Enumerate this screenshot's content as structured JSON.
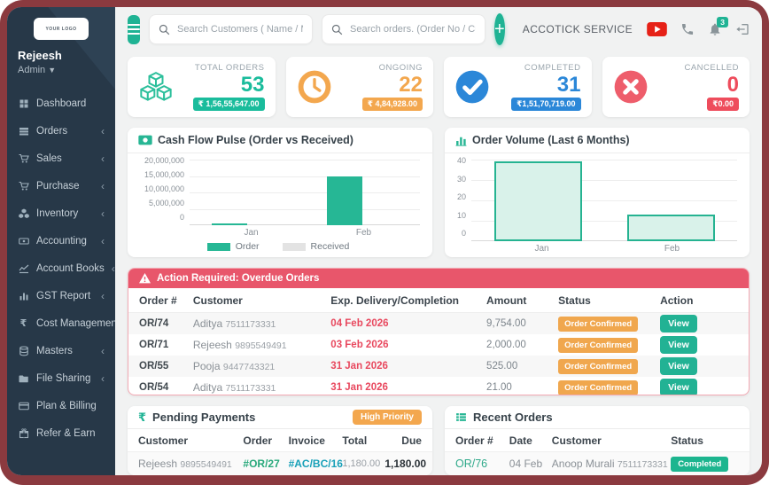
{
  "sidebar": {
    "logo_text": "YOUR LOGO",
    "user_name": "Rejeesh",
    "user_role": "Admin",
    "items": [
      {
        "label": "Dashboard",
        "expandable": false
      },
      {
        "label": "Orders",
        "expandable": true
      },
      {
        "label": "Sales",
        "expandable": true
      },
      {
        "label": "Purchase",
        "expandable": true
      },
      {
        "label": "Inventory",
        "expandable": true
      },
      {
        "label": "Accounting",
        "expandable": true
      },
      {
        "label": "Account Books",
        "expandable": true
      },
      {
        "label": "GST Report",
        "expandable": true
      },
      {
        "label": "Cost Management",
        "expandable": true
      },
      {
        "label": "Masters",
        "expandable": true
      },
      {
        "label": "File Sharing",
        "expandable": true
      },
      {
        "label": "Plan & Billing",
        "expandable": false
      },
      {
        "label": "Refer & Earn",
        "expandable": false
      }
    ],
    "chevron": "‹"
  },
  "header": {
    "search_customers_placeholder": "Search Customers ( Name / Mobile / GSTIN",
    "search_orders_placeholder": "Search orders. (Order No / Customer Name,",
    "add_button": "+",
    "company_name": "ACCOTICK SERVICE",
    "notification_count": "3"
  },
  "stats": [
    {
      "label": "TOTAL ORDERS",
      "value": "53",
      "amount": "₹ 1,56,55,647.00",
      "color": "#1abc9c",
      "icon": "cubes-icon"
    },
    {
      "label": "ONGOING",
      "value": "22",
      "amount": "₹ 4,84,928.00",
      "color": "#f3a74e",
      "icon": "clock-icon"
    },
    {
      "label": "COMPLETED",
      "value": "31",
      "amount": "₹1,51,70,719.00",
      "color": "#2b87d8",
      "icon": "check-circle-icon"
    },
    {
      "label": "CANCELLED",
      "value": "0",
      "amount": "₹0.00",
      "color": "#ee5d6b",
      "icon": "x-circle-icon"
    }
  ],
  "chart_data": [
    {
      "type": "bar",
      "title": "Cash Flow Pulse (Order vs Received)",
      "categories": [
        "Jan",
        "Feb"
      ],
      "series": [
        {
          "name": "Order",
          "values": [
            500000,
            15000000
          ],
          "color": "#26b795"
        },
        {
          "name": "Received",
          "values": [
            0,
            0
          ],
          "color": "#e3e3e3"
        }
      ],
      "ylim": [
        0,
        20000000
      ],
      "yticks": [
        "20,000,000",
        "15,000,000",
        "10,000,000",
        "5,000,000",
        "0"
      ],
      "legend_position": "bottom",
      "grid": true
    },
    {
      "type": "bar",
      "title": "Order Volume (Last 6 Months)",
      "categories": [
        "Jan",
        "Feb"
      ],
      "values": [
        39,
        13
      ],
      "ylim": [
        0,
        40
      ],
      "yticks": [
        "40",
        "30",
        "20",
        "10",
        "0"
      ],
      "legend_position": "none",
      "grid": true
    }
  ],
  "overdue": {
    "title": "Action Required: Overdue Orders",
    "columns": [
      "Order #",
      "Customer",
      "Exp. Delivery/Completion",
      "Amount",
      "Status",
      "Action"
    ],
    "rows": [
      {
        "order_no": "OR/74",
        "customer": "Aditya",
        "phone": "7511173331",
        "due_date": "04 Feb 2026",
        "amount": "9,754.00",
        "status": "Order Confirmed",
        "action": "View"
      },
      {
        "order_no": "OR/71",
        "customer": "Rejeesh",
        "phone": "9895549491",
        "due_date": "03 Feb 2026",
        "amount": "2,000.00",
        "status": "Order Confirmed",
        "action": "View"
      },
      {
        "order_no": "OR/55",
        "customer": "Pooja",
        "phone": "9447743321",
        "due_date": "31 Jan 2026",
        "amount": "525.00",
        "status": "Order Confirmed",
        "action": "View"
      },
      {
        "order_no": "OR/54",
        "customer": "Aditya",
        "phone": "7511173331",
        "due_date": "31 Jan 2026",
        "amount": "21.00",
        "status": "Order Confirmed",
        "action": "View"
      }
    ]
  },
  "pending_payments": {
    "title": "Pending Payments",
    "priority_badge": "High Priority",
    "columns": [
      "Customer",
      "Order",
      "Invoice",
      "Total",
      "Due"
    ],
    "rows": [
      {
        "customer": "Rejeesh",
        "phone": "9895549491",
        "order": "#OR/27",
        "invoice": "#AC/BC/16",
        "total": "1,180.00",
        "due": "1,180.00"
      }
    ]
  },
  "recent_orders": {
    "title": "Recent Orders",
    "columns": [
      "Order #",
      "Date",
      "Customer",
      "Status"
    ],
    "rows": [
      {
        "order_no": "OR/76",
        "date": "04 Feb",
        "customer": "Anoop Murali",
        "phone": "7511173331",
        "status": "Completed"
      }
    ]
  },
  "colors": {
    "primary_teal": "#1fb394",
    "sidebar_bg": "#273848",
    "frame": "#8b3a3f",
    "alert_red": "#e8566b",
    "orange": "#f3a74e",
    "blue": "#2b87d8",
    "pink_red": "#ee5d6b"
  }
}
